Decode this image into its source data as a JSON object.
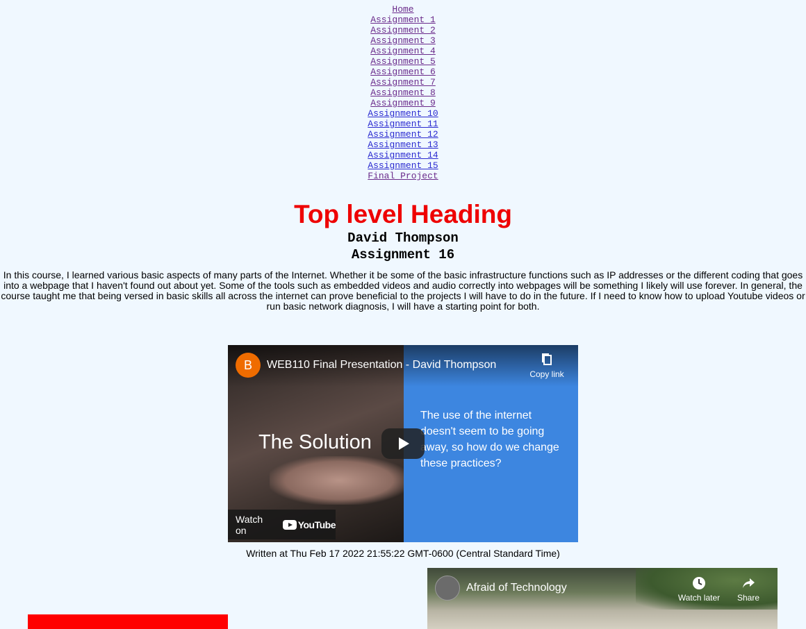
{
  "nav": {
    "links": [
      {
        "label": "Home",
        "visited": true
      },
      {
        "label": "Assignment 1",
        "visited": true
      },
      {
        "label": "Assignment 2",
        "visited": true
      },
      {
        "label": "Assignment 3",
        "visited": true
      },
      {
        "label": "Assignment 4",
        "visited": true
      },
      {
        "label": "Assignment 5",
        "visited": true
      },
      {
        "label": "Assignment 6",
        "visited": true
      },
      {
        "label": "Assignment 7",
        "visited": true
      },
      {
        "label": "Assignment 8",
        "visited": true
      },
      {
        "label": "Assignment 9",
        "visited": true
      },
      {
        "label": "Assignment 10",
        "visited": false
      },
      {
        "label": "Assignment 11",
        "visited": false
      },
      {
        "label": "Assignment 12",
        "visited": false
      },
      {
        "label": "Assignment 13",
        "visited": false
      },
      {
        "label": "Assignment 14",
        "visited": false
      },
      {
        "label": "Assignment 15",
        "visited": false
      },
      {
        "label": "Final Project",
        "visited": true
      }
    ]
  },
  "heading": "Top level Heading",
  "author": "David Thompson",
  "assignment_title": "Assignment 16",
  "paragraph": "In this course, I learned various basic aspects of many parts of the Internet. Whether it be some of the basic infrastructure functions such as IP addresses or the different coding that goes into a webpage that I haven't found out about yet. Some of the tools such as embedded videos and audio correctly into webpages will be something I likely will use forever. In general, the course taught me that being versed in basic skills all across the internet can prove beneficial to the projects I will have to do in the future. If I need to know how to upload Youtube videos or run basic network diagnosis, I will have a starting point for both.",
  "video1": {
    "channel_initial": "B",
    "title": "WEB110 Final Presentation - David Thompson",
    "copy_link": "Copy link",
    "slide_left": "The Solution",
    "slide_right": "The use of the internet doesn't seem to be going away, so how do we change these practices?",
    "watch_on": "Watch on",
    "youtube": "YouTube"
  },
  "written_at": "Written at Thu Feb 17 2022 21:55:22 GMT-0600 (Central Standard Time)",
  "video2": {
    "title": "Afraid of Technology",
    "watch_later": "Watch later",
    "share": "Share"
  },
  "colors": {
    "background": "#f0f8ff",
    "heading": "#ee0000",
    "link": "#2a2ad0",
    "visited_link": "#6a2a8a",
    "red_box": "#ff0000"
  }
}
